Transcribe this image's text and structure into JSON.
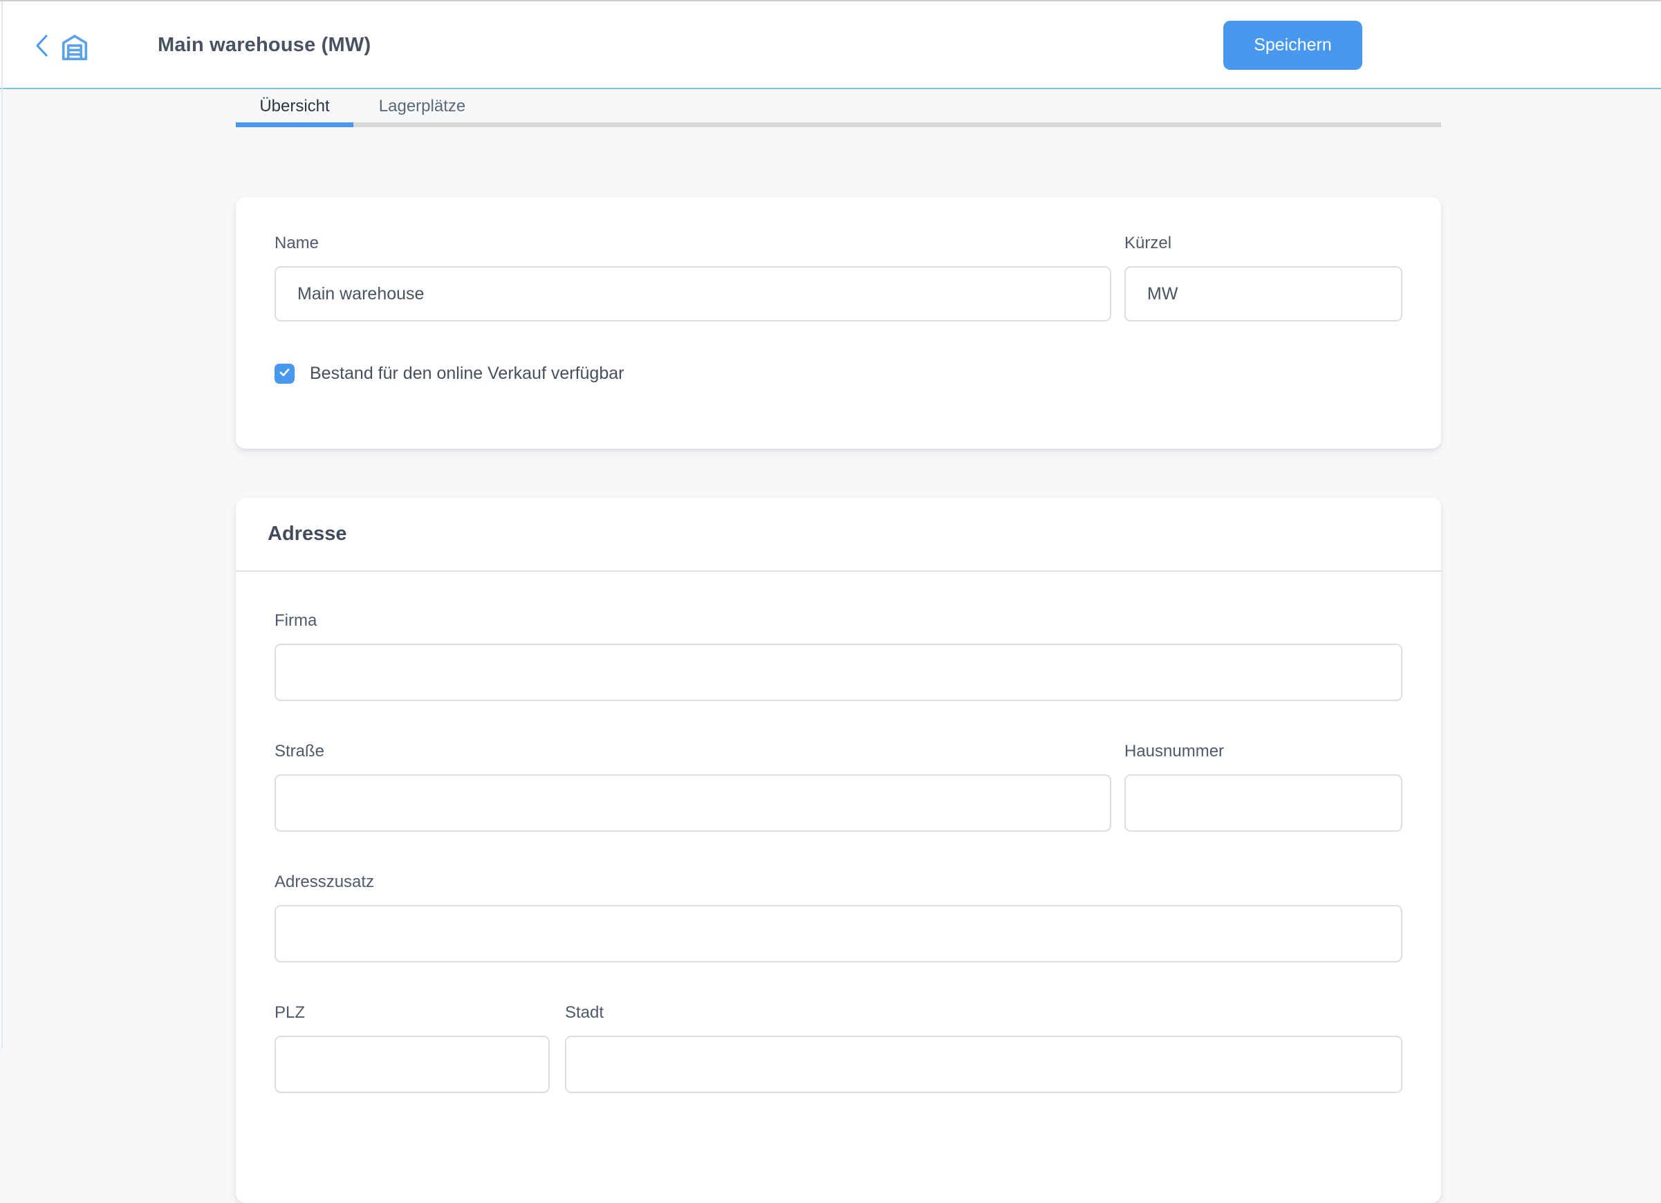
{
  "header": {
    "title": "Main warehouse (MW)",
    "save_label": "Speichern"
  },
  "tabs": [
    {
      "label": "Übersicht",
      "active": true
    },
    {
      "label": "Lagerplätze",
      "active": false
    }
  ],
  "general": {
    "name_label": "Name",
    "name_value": "Main warehouse",
    "code_label": "Kürzel",
    "code_value": "MW",
    "checkbox_label": "Bestand für den online Verkauf verfügbar",
    "checkbox_checked": true
  },
  "address": {
    "heading": "Adresse",
    "firma_label": "Firma",
    "firma_value": "",
    "strasse_label": "Straße",
    "strasse_value": "",
    "hausnummer_label": "Hausnummer",
    "hausnummer_value": "",
    "adresszusatz_label": "Adresszusatz",
    "adresszusatz_value": "",
    "plz_label": "PLZ",
    "plz_value": "",
    "stadt_label": "Stadt",
    "stadt_value": ""
  },
  "icons": {
    "back": "chevron-left-icon",
    "warehouse": "warehouse-icon",
    "check": "checkmark-icon"
  },
  "colors": {
    "accent": "#4798EE",
    "header_border": "#7CC0EE",
    "tab_track": "#D7D9DB",
    "page_bg": "#F7F8FA",
    "card_bg": "#FFFFFF",
    "input_border": "#D9DEE3",
    "title_text": "#475263",
    "label_text": "#4E5A6B"
  }
}
